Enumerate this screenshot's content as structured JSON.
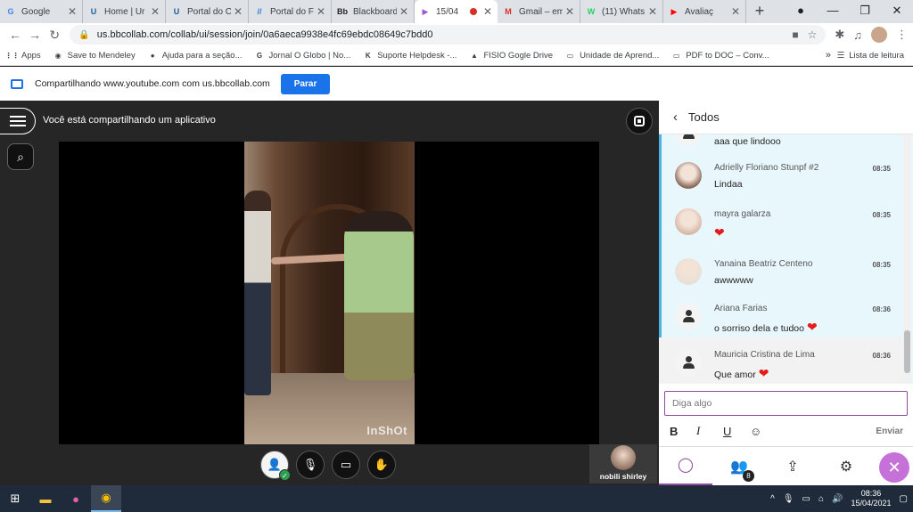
{
  "tabs": [
    {
      "label": "Google",
      "icon": "G",
      "color": "#4285f4"
    },
    {
      "label": "Home | Ur",
      "icon": "U",
      "color": "#1a5e9e"
    },
    {
      "label": "Portal do C",
      "icon": "U",
      "color": "#1a5e9e"
    },
    {
      "label": "Portal do F",
      "icon": "//",
      "color": "#2a7bd0"
    },
    {
      "label": "Blackboard",
      "icon": "Bb",
      "color": "#222222"
    },
    {
      "label": "15/04",
      "icon": "▶",
      "color": "#9b59d0",
      "active": true
    },
    {
      "label": "Gmail – em",
      "icon": "M",
      "color": "#d93025"
    },
    {
      "label": "(11) Whats",
      "icon": "W",
      "color": "#25d366"
    },
    {
      "label": "Avaliaç",
      "icon": "▶",
      "color": "#ff0000"
    }
  ],
  "address": {
    "url": "us.bbcollab.com/collab/ui/session/join/0a6aeca9938e4fc69ebdc08649c7bdd0"
  },
  "bookmarks": [
    {
      "label": "Apps",
      "icon": "⋮⋮"
    },
    {
      "label": "Save to Mendeley",
      "icon": "◉"
    },
    {
      "label": "Ajuda para a seção...",
      "icon": "●"
    },
    {
      "label": "Jornal O Globo | No...",
      "icon": "G"
    },
    {
      "label": "Suporte Helpdesk -...",
      "icon": "K"
    },
    {
      "label": "FISIO Gogle Drive",
      "icon": "▲"
    },
    {
      "label": "Unidade de Aprend...",
      "icon": "▭"
    },
    {
      "label": "PDF to DOC – Conv...",
      "icon": "▭"
    }
  ],
  "bookmarks_more": "»",
  "reading_list": "Lista de leitura",
  "sharebar": {
    "text": "Compartilhando www.youtube.com com us.bbcollab.com",
    "stop_label": "Parar"
  },
  "main": {
    "sharing_text": "Você está compartilhando um aplicativo",
    "watermark": "InShOt"
  },
  "participant_tile": {
    "name": "nobili shirley"
  },
  "panel": {
    "title": "Todos",
    "messages": [
      {
        "author": "",
        "time": "",
        "text": "aaa que lindooo",
        "heart": false,
        "avatar": "generic"
      },
      {
        "author": "Adrielly Floriano Stunpf #2",
        "time": "08:35",
        "text": "Lindaa",
        "heart": false,
        "avatar": "photo",
        "avatar_color": "#8a6a5a"
      },
      {
        "author": "mayra galarza",
        "time": "08:35",
        "text": "",
        "heart": true,
        "avatar": "photo",
        "avatar_color": "#d8b8a8"
      },
      {
        "author": "Yanaina Beatriz Centeno",
        "time": "08:35",
        "text": "awwwww",
        "heart": false,
        "avatar": "photo",
        "avatar_color": "#e8e0d8"
      },
      {
        "author": "Ariana Farias",
        "time": "08:36",
        "text": "o sorriso dela e tudoo",
        "heart": true,
        "avatar": "generic"
      },
      {
        "author": "Mauricia Cristina de Lima",
        "time": "08:36",
        "text": "Que amor",
        "heart": true,
        "avatar": "generic"
      }
    ],
    "composer_placeholder": "Diga algo",
    "send_label": "Enviar",
    "attendee_count": "8",
    "accent": "#8c4ba0"
  },
  "taskbar": {
    "time": "08:36",
    "date": "15/04/2021"
  }
}
